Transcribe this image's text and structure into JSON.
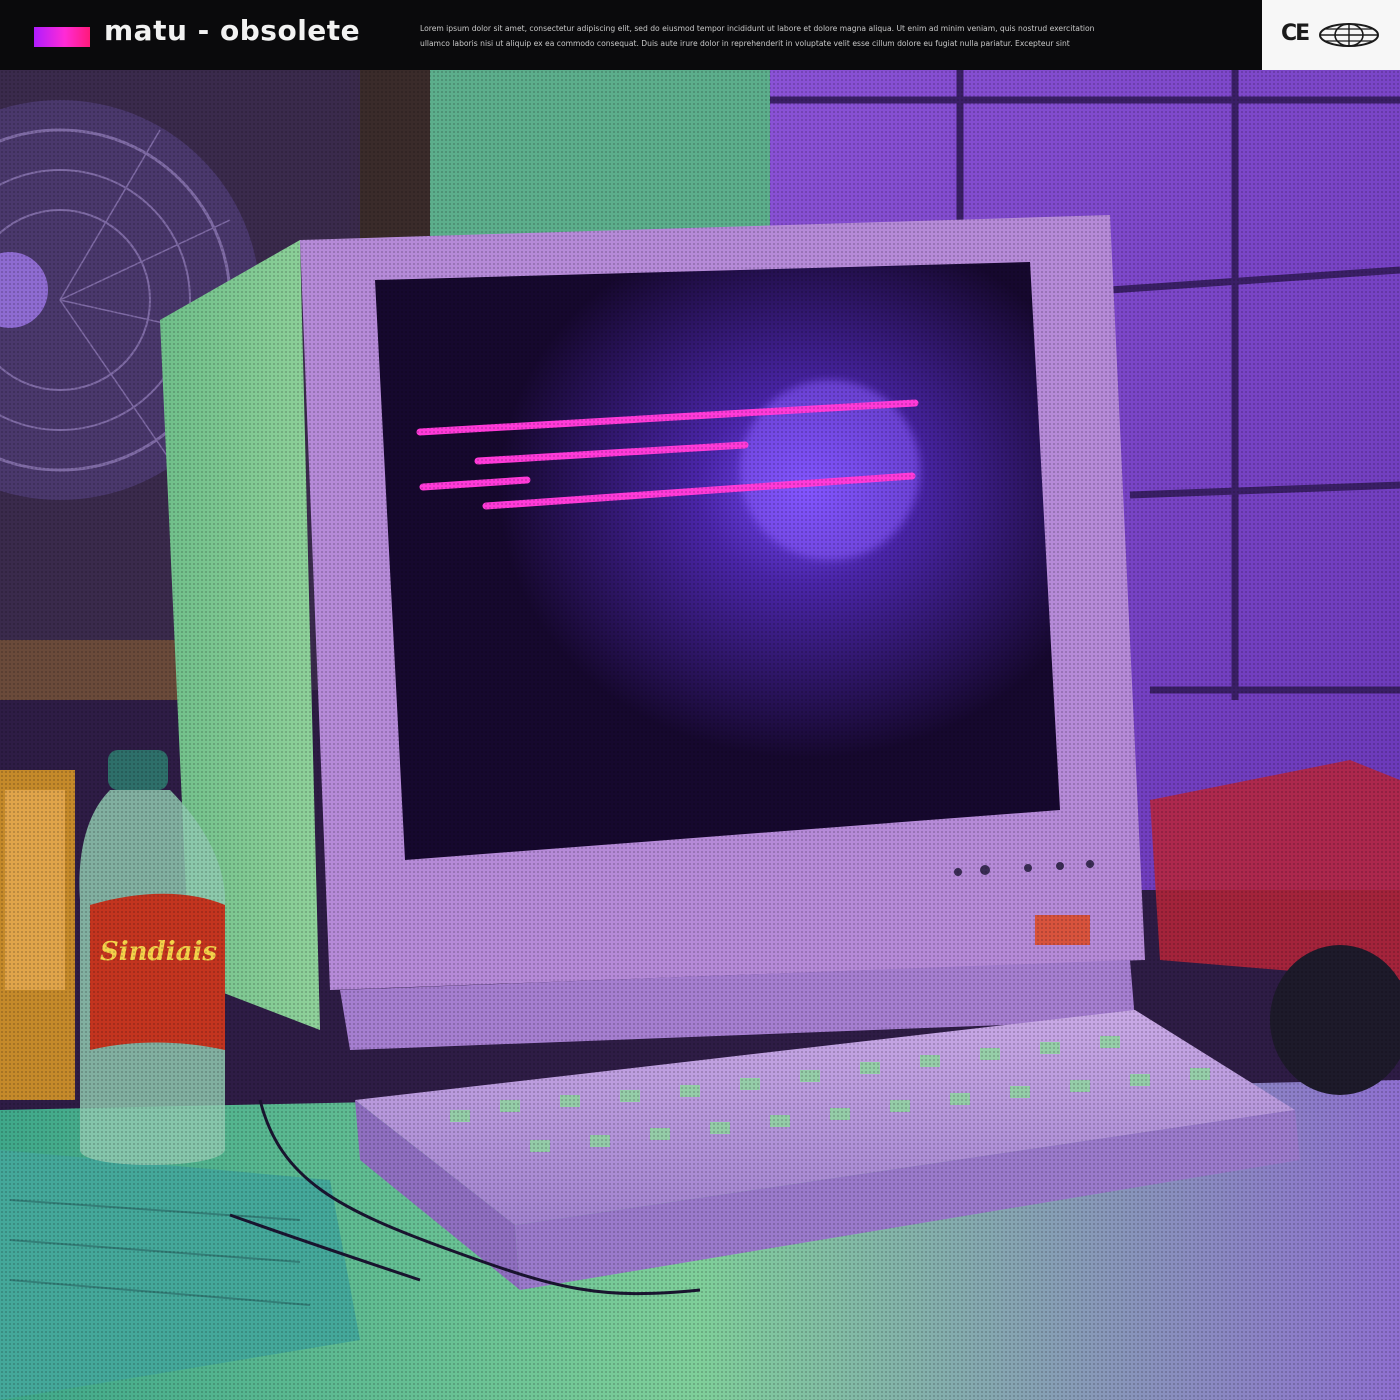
{
  "header": {
    "title": "matu - obsolete",
    "lorem_line_1": "Lorem ipsum dolor sit amet, consectetur adipiscing elit, sed do eiusmod tempor incididunt ut labore et dolore magna aliqua. Ut enim ad minim veniam, quis nostrud exercitation",
    "lorem_line_2": "ullamco laboris nisi ut aliquip ex ea commodo consequat. Duis aute irure dolor in reprehenderit in voluptate velit esse cillum dolore eu fugiat nulla pariatur. Excepteur sint",
    "ce_mark": "CE",
    "swatch_colors": [
      "#b01cff",
      "#ff2bd6",
      "#ff1a7a"
    ]
  },
  "photo": {
    "bottle_label": "Sindiais",
    "icons": [
      "globe-icon",
      "ce-mark"
    ],
    "palette": {
      "wall": "#7d48c9",
      "monitor": "#b88ad8",
      "screen_glow": "#6f3dff",
      "neon": "#ff3ad9",
      "desk": "#6fc49a",
      "keyboard": "#c7a7e3",
      "fan": "#4a2f6e"
    }
  }
}
